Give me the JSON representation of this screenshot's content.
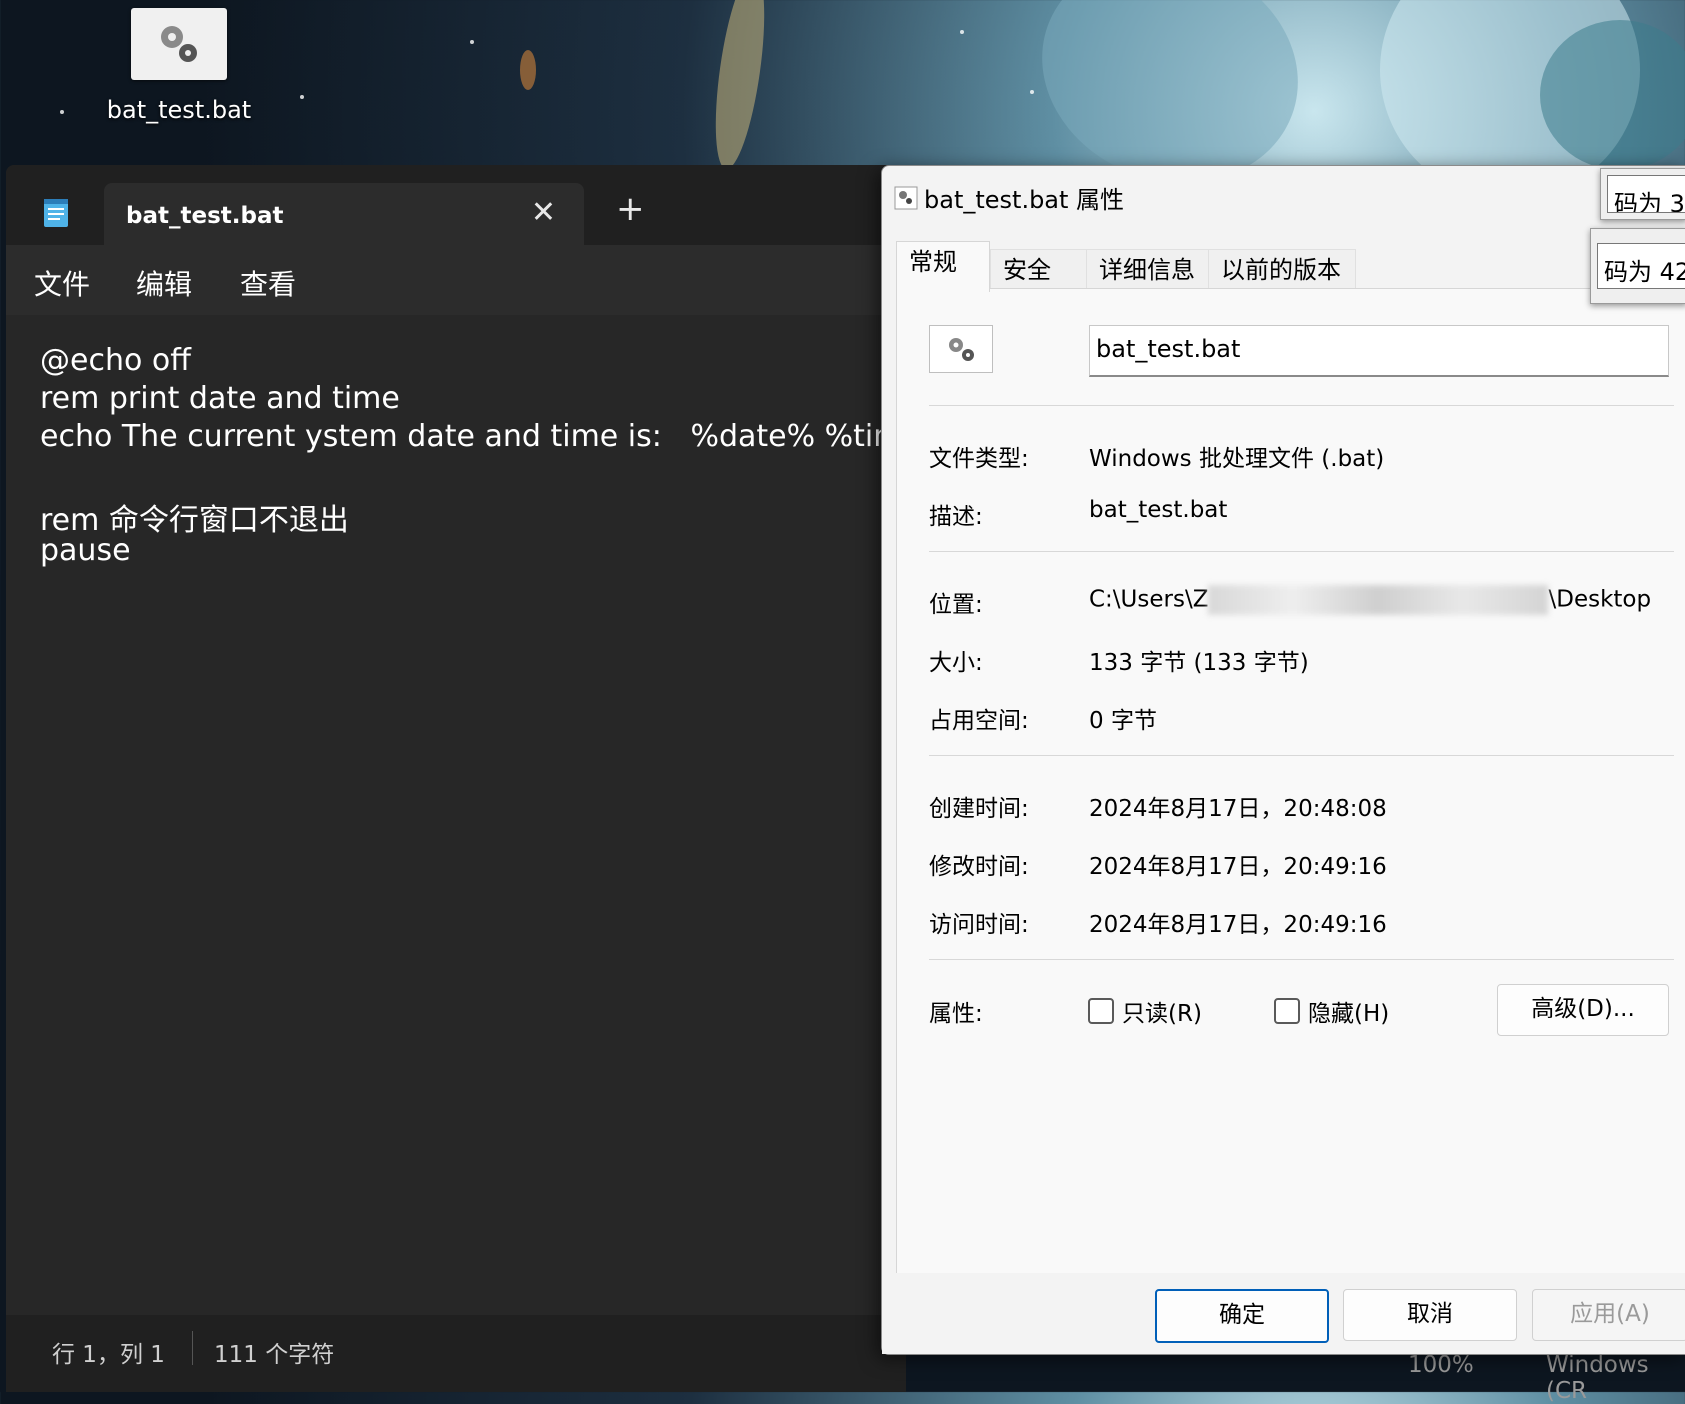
{
  "desktop": {
    "icon_label": "bat_test.bat"
  },
  "notepad": {
    "tab_title": "bat_test.bat",
    "tab_close": "✕",
    "new_tab": "+",
    "menu": [
      "文件",
      "编辑",
      "查看"
    ],
    "lines": [
      "@echo off",
      "rem print date and time",
      "echo The current ystem date and time is:   %date% %time%",
      "",
      "rem 命令行窗口不退出",
      "pause"
    ],
    "status": {
      "position": "行 1，列 1",
      "chars": "111 个字符",
      "zoom": "100%",
      "encoding": "Windows (CR"
    }
  },
  "dialog": {
    "title": "bat_test.bat 属性",
    "tabs": [
      "常规",
      "安全",
      "详细信息",
      "以前的版本"
    ],
    "filename": "bat_test.bat",
    "props": {
      "type_label": "文件类型:",
      "type_value": "Windows 批处理文件 (.bat)",
      "desc_label": "描述:",
      "desc_value": "bat_test.bat",
      "loc_label": "位置:",
      "loc_prefix": "C:\\Users\\Z",
      "loc_suffix": "\\Desktop",
      "size_label": "大小:",
      "size_value": "133 字节 (133 字节)",
      "disk_label": "占用空间:",
      "disk_value": "0 字节",
      "created_label": "创建时间:",
      "created_value": "2024年8月17日，20:48:08",
      "modified_label": "修改时间:",
      "modified_value": "2024年8月17日，20:49:16",
      "accessed_label": "访问时间:",
      "accessed_value": "2024年8月17日，20:49:16",
      "attr_label": "属性:",
      "readonly": "只读(R)",
      "hidden": "隐藏(H)",
      "advanced": "高级(D)..."
    },
    "buttons": {
      "ok": "确定",
      "cancel": "取消",
      "apply": "应用(A)"
    }
  },
  "peek": {
    "a": "码为 3",
    "b": "码为 42"
  }
}
